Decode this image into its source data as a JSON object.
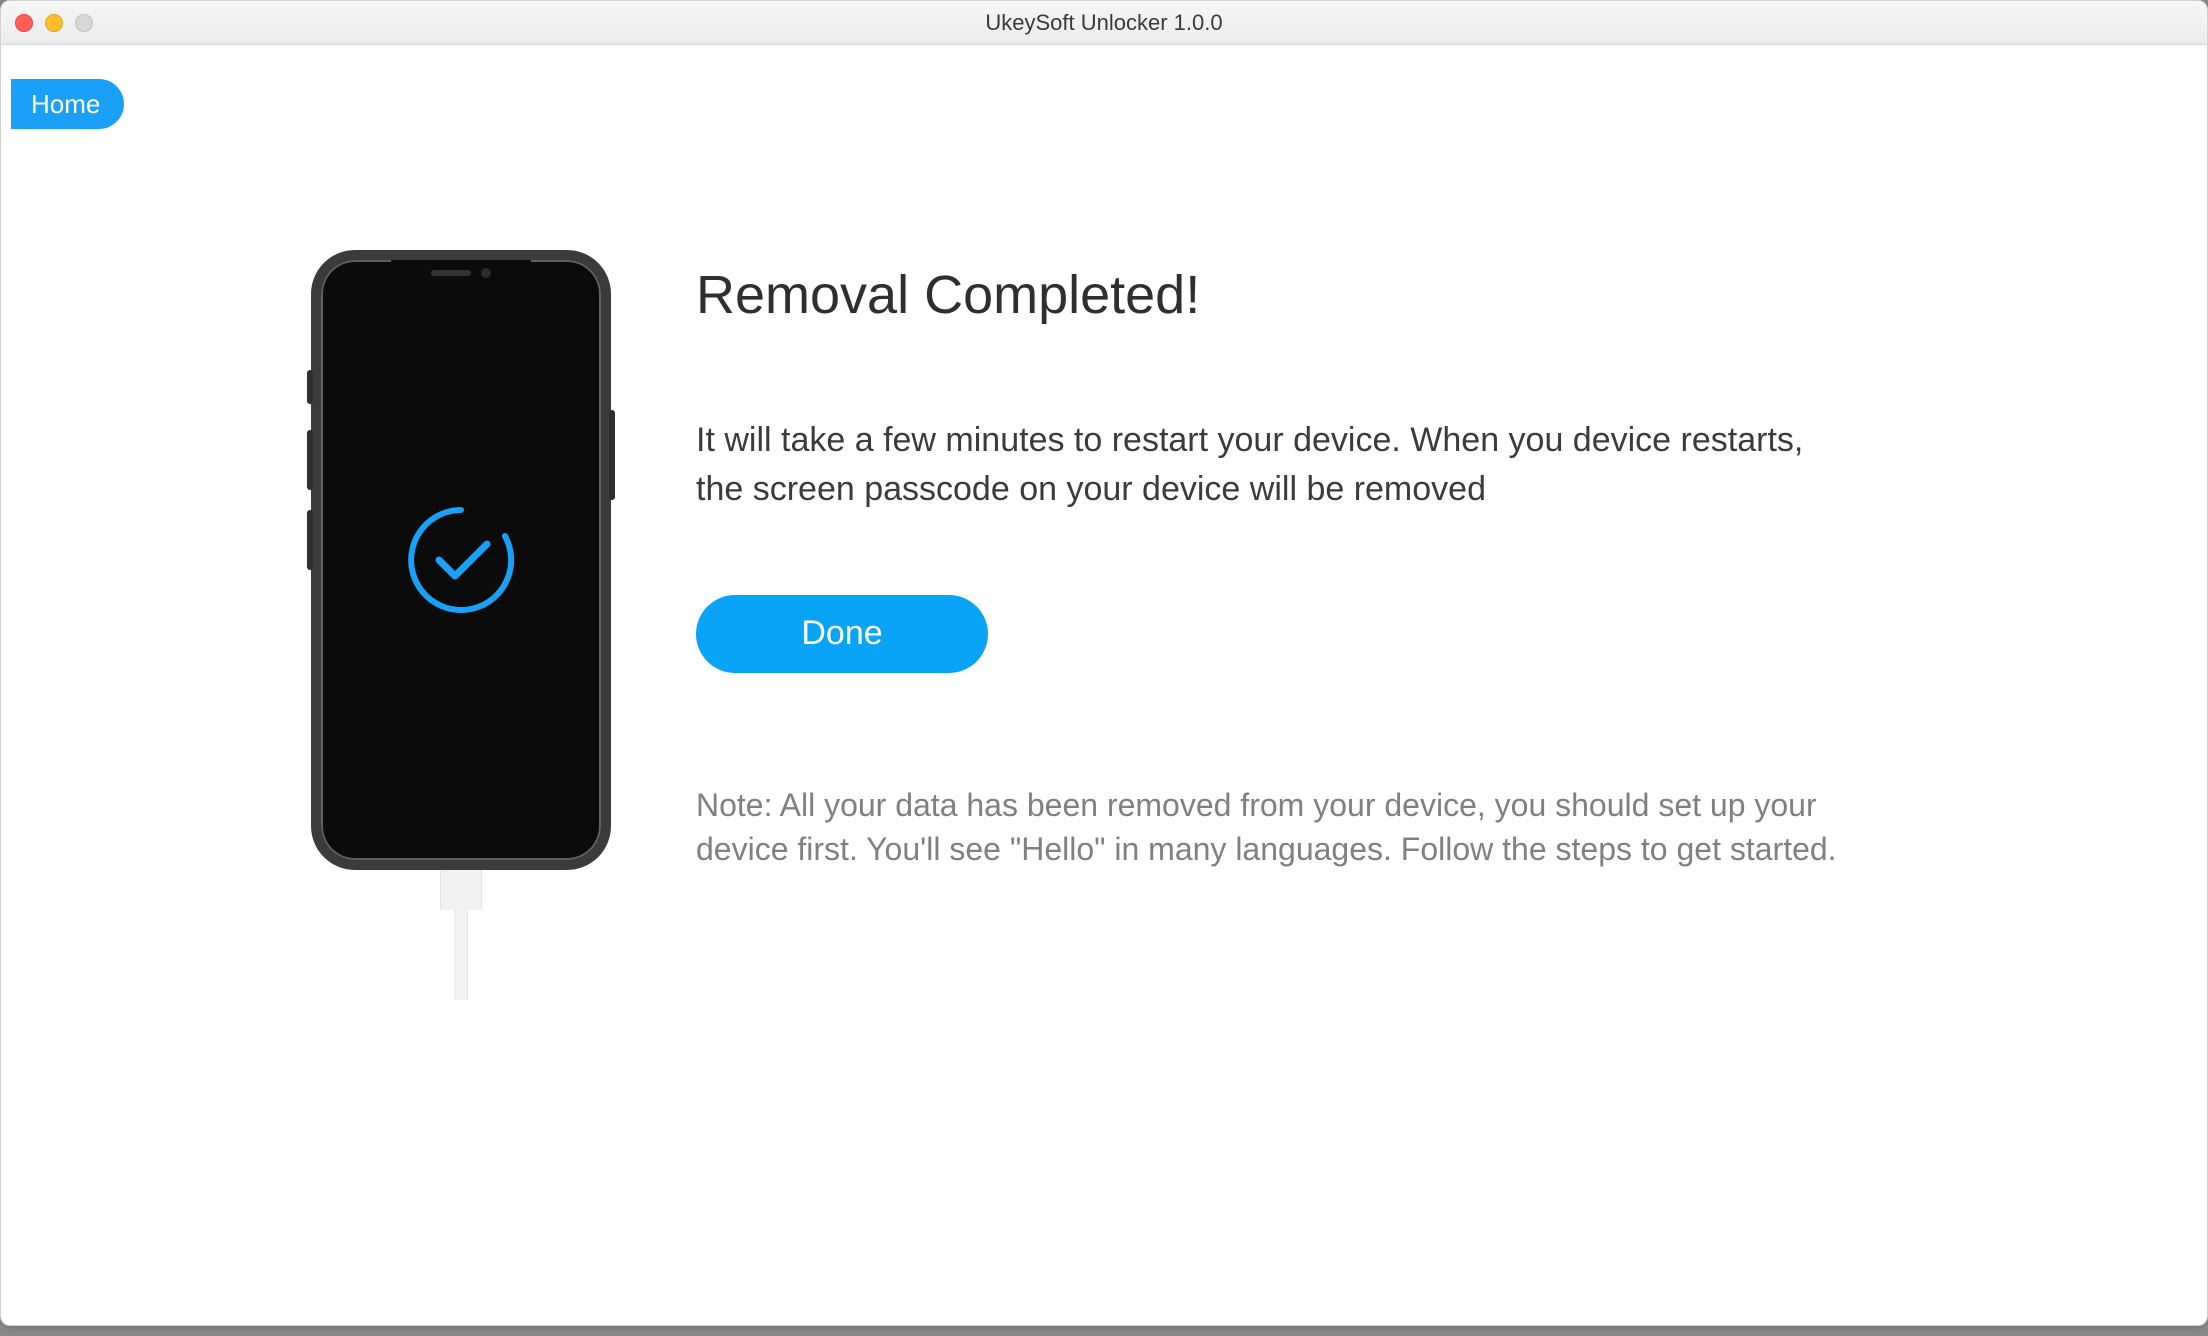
{
  "window": {
    "title": "UkeySoft Unlocker 1.0.0"
  },
  "nav": {
    "home_label": "Home"
  },
  "status": {
    "headline": "Removal Completed!",
    "description": "It will take a few minutes to restart your device. When you device restarts, the screen passcode on your device will be removed",
    "done_label": "Done",
    "note": "Note: All your data has been removed from your device, you should set up your device first. You'll see \"Hello\" in many languages. Follow the steps to get started."
  },
  "colors": {
    "accent": "#0aa4f6"
  },
  "icons": {
    "phone_check": "checkmark-circle-icon"
  }
}
